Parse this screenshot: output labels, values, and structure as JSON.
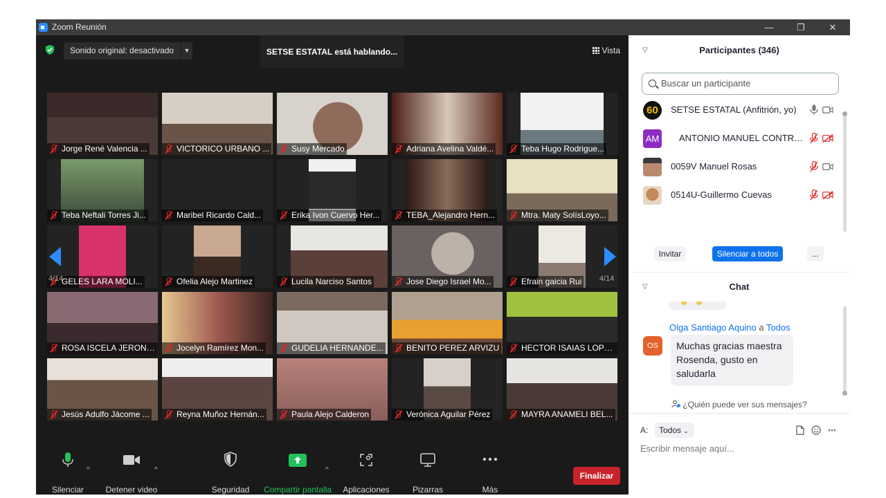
{
  "window": {
    "title": "Zoom Reunión",
    "buttons": {
      "minimize": "—",
      "restore": "❐",
      "close": "✕"
    }
  },
  "topbar": {
    "audio_label": "Sonido original: desactivado",
    "speaking": "SETSE ESTATAL está hablando...",
    "view_label": "Vista"
  },
  "gallery": {
    "page_left": "4/14",
    "page_right": "4/14",
    "tiles": [
      {
        "name": "Jorge René Valencia ..."
      },
      {
        "name": "VICTORICO URBANO ..."
      },
      {
        "name": "Susy Mercado"
      },
      {
        "name": "Adriana Avelina Valdé..."
      },
      {
        "name": "Teba Hugo Rodrigue..."
      },
      {
        "name": "Teba Neftali Torres Ji..."
      },
      {
        "name": "Maribel Ricardo Cald..."
      },
      {
        "name": "Erika Ivon Cuervo Her..."
      },
      {
        "name": "TEBA_Alejandro Hern..."
      },
      {
        "name": "Mtra. Maty SolísLoyo..."
      },
      {
        "name": "GELES LARA MOLI..."
      },
      {
        "name": "Ofelia Alejo Martinez"
      },
      {
        "name": "Lucila Narciso Santos"
      },
      {
        "name": "Jose Diego Israel Mo..."
      },
      {
        "name": "Efrain gaicia Rui"
      },
      {
        "name": "ROSA ISCELA JERONI..."
      },
      {
        "name": "Jocelyn Ramírez Mon..."
      },
      {
        "name": "GUDELIA HERNANDE..."
      },
      {
        "name": "BENITO PEREZ ARVIZU"
      },
      {
        "name": "HECTOR ISAIAS LOPE..."
      },
      {
        "name": "Jesús Adulfo Jácome ..."
      },
      {
        "name": "Reyna Muñoz Hernán..."
      },
      {
        "name": "Paula Alejo Calderon"
      },
      {
        "name": "Verónica Aguilar Pérez"
      },
      {
        "name": "MAYRA ANAMELI BEL..."
      }
    ]
  },
  "toolbar": {
    "mute": "Silenciar",
    "video": "Detener video",
    "security": "Seguridad",
    "share": "Compartir pantalla",
    "apps": "Aplicaciones",
    "whiteboards": "Pizarras",
    "more": "Más",
    "end": "Finalizar"
  },
  "participants": {
    "title": "Participantes (346)",
    "search_placeholder": "Buscar un participante",
    "list": [
      {
        "name": "SETSE ESTATAL (Anfitrión, yo)",
        "avatar": "60"
      },
      {
        "name": "ANTONIO MANUEL CONTRE...",
        "avatar": "AM"
      },
      {
        "name": "0059V Manuel Rosas",
        "avatar": ""
      },
      {
        "name": "0514U-Guillermo Cuevas",
        "avatar": ""
      }
    ],
    "invite": "Invitar",
    "mute_all": "Silenciar a todos",
    "more": "..."
  },
  "chat": {
    "title": "Chat",
    "sender": "Olga Santiago Aquino",
    "to_word": "a",
    "recipient": "Todos",
    "avatar": "OS",
    "message": "Muchas gracias maestra Rosenda, gusto en saludarla",
    "who_can_see": "¿Quién puede ver sus mensajes?",
    "to_label": "A:",
    "to_value": "Todos",
    "input_placeholder": "Escribir mensaje aquí..."
  }
}
